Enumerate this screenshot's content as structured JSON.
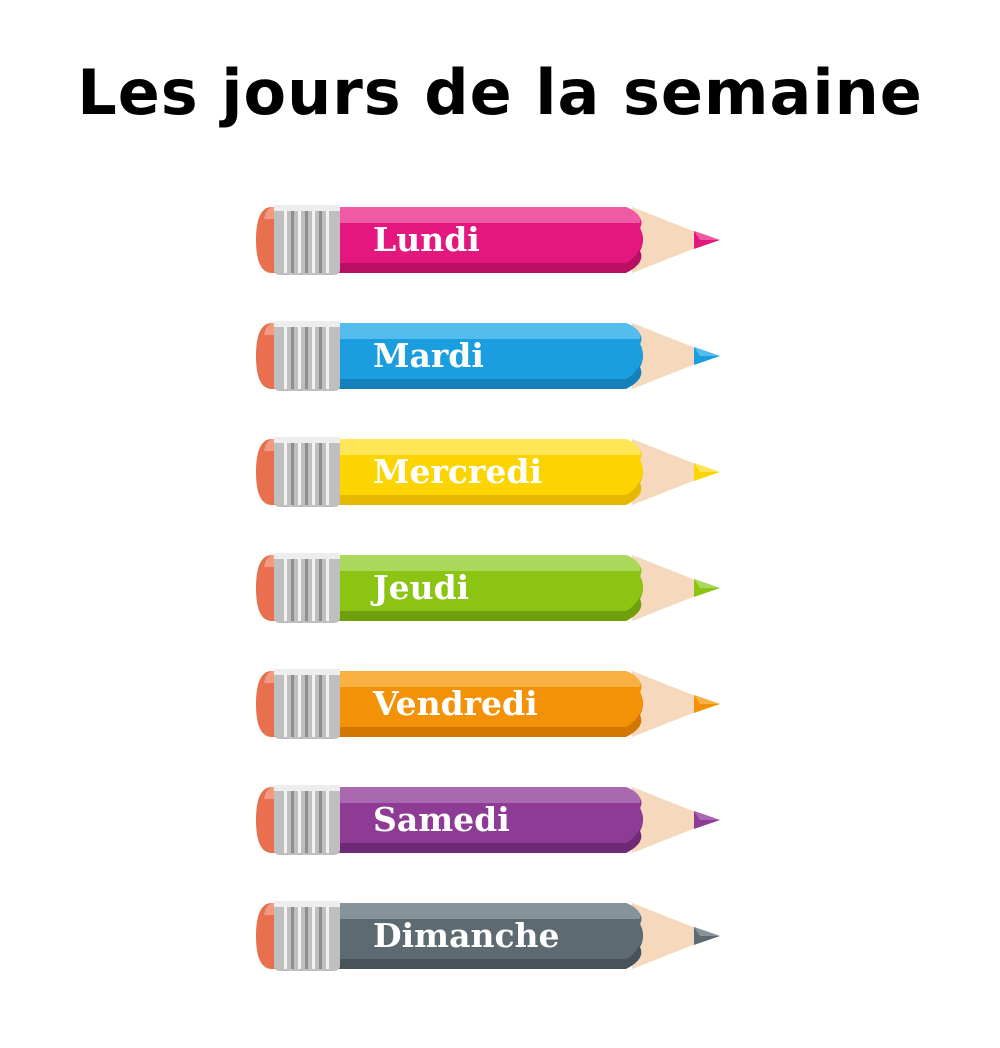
{
  "title": "Les jours de la semaine",
  "days": [
    {
      "label": "Lundi",
      "color": "#e4177f",
      "light": "#f05aa5",
      "dark": "#b80e64"
    },
    {
      "label": "Mardi",
      "color": "#1b9ee0",
      "light": "#55bdee",
      "dark": "#1680bb"
    },
    {
      "label": "Mercredi",
      "color": "#fcd500",
      "light": "#ffe657",
      "dark": "#e7b800"
    },
    {
      "label": "Jeudi",
      "color": "#8cc414",
      "light": "#a9d85a",
      "dark": "#6f9f0c"
    },
    {
      "label": "Vendredi",
      "color": "#f39207",
      "light": "#f9b142",
      "dark": "#d37700"
    },
    {
      "label": "Samedi",
      "color": "#8e3b96",
      "light": "#aa68b0",
      "dark": "#6f2a77"
    },
    {
      "label": "Dimanche",
      "color": "#5d6a71",
      "light": "#87939a",
      "dark": "#485359"
    }
  ],
  "colors": {
    "eraser": "#e8704f",
    "ferrule": "#bfbfbf",
    "wood": "#f6d8bc"
  },
  "icons": {
    "pencil": "pencil-icon"
  }
}
